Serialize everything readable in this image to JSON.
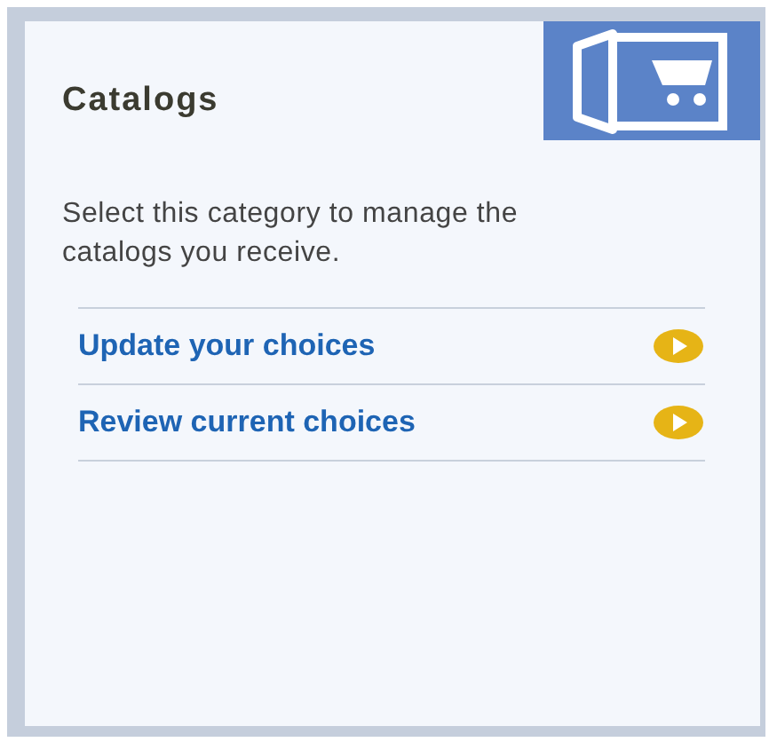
{
  "card": {
    "title": "Catalogs",
    "description": "Select this category to manage the catalogs you receive.",
    "links": [
      {
        "label": "Update your choices"
      },
      {
        "label": "Review current choices"
      }
    ]
  }
}
